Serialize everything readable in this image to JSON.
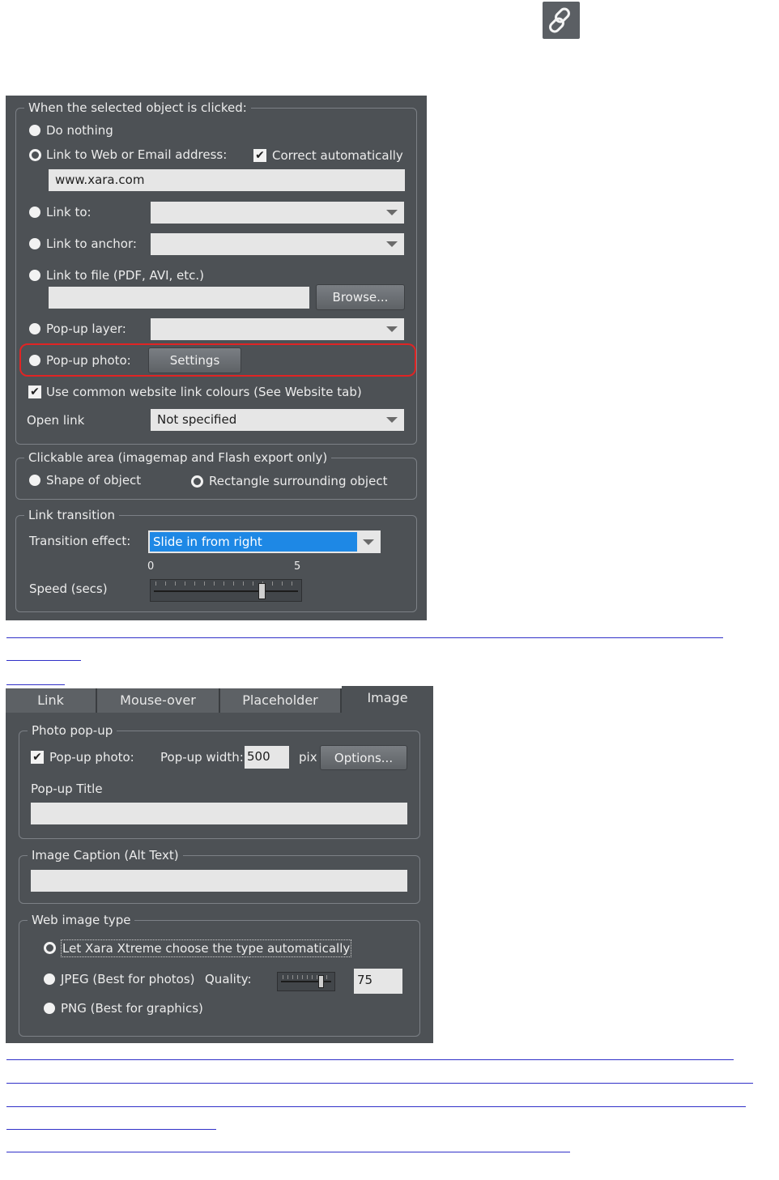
{
  "colors": {
    "panel_bg": "#4d5155",
    "highlight_border": "#e02424",
    "selection_blue": "#1e88e5",
    "link_underline": "#3030c8"
  },
  "top_icon": "link-chain-icon",
  "link_dialog": {
    "group_when_clicked": "When the selected object is clicked:",
    "do_nothing": "Do nothing",
    "link_web_email": "Link to Web or Email address:",
    "correct_automatically": "Correct automatically",
    "url_value": "www.xara.com",
    "link_to": "Link to:",
    "link_to_anchor": "Link to anchor:",
    "link_to_file": "Link to file (PDF, AVI, etc.)",
    "browse_button": "Browse...",
    "popup_layer": "Pop-up layer:",
    "popup_photo": "Pop-up photo:",
    "settings_button": "Settings",
    "use_common_colours": "Use common website link colours (See Website tab)",
    "open_link": "Open link",
    "open_link_value": "Not specified",
    "group_clickable_area": "Clickable area (imagemap and Flash export only)",
    "shape_of_object": "Shape of object",
    "rectangle_surrounding": "Rectangle surrounding object",
    "group_link_transition": "Link transition",
    "transition_effect": "Transition effect:",
    "transition_value": "Slide in from right",
    "speed_min": "0",
    "speed_max": "5",
    "speed_label": "Speed (secs)",
    "speed_level": 0.74
  },
  "image_dialog": {
    "tabs": [
      "Link",
      "Mouse-over",
      "Placeholder",
      "Image"
    ],
    "active_tab": "Image",
    "group_photo_popup": "Photo pop-up",
    "popup_photo": "Pop-up photo:",
    "popup_width_label": "Pop-up width:",
    "popup_width_value": "500",
    "pix": "pix",
    "options_button": "Options...",
    "popup_title": "Pop-up Title",
    "group_caption": "Image Caption (Alt Text)",
    "group_web_image_type": "Web image type",
    "let_xara_choose": "Let Xara Xtreme choose the type automatically",
    "jpeg": "JPEG (Best for photos)",
    "quality_label": "Quality:",
    "quality_value": "75",
    "png": "PNG (Best for graphics)"
  }
}
